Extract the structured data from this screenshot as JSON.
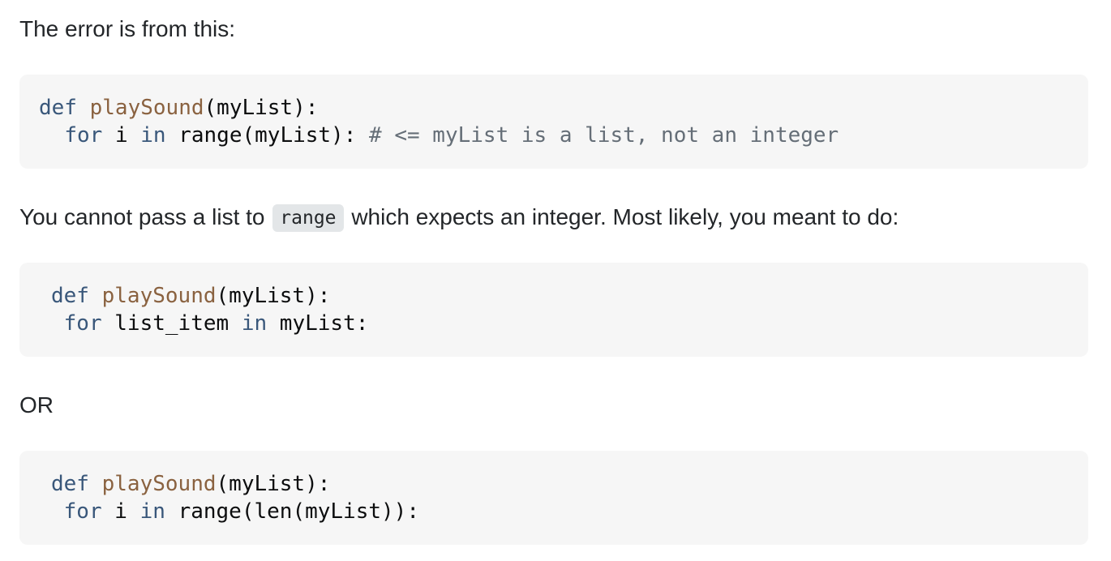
{
  "paragraphs": {
    "intro": "The error is from this:",
    "explanation_before": "You cannot pass a list to",
    "explanation_code": "range",
    "explanation_after": "which expects an integer. Most likely, you meant to do:",
    "or": "OR"
  },
  "code_blocks": [
    {
      "lines": [
        {
          "kw1": "def",
          "fn": "playSound",
          "rest": "(myList):"
        },
        {
          "kw1": "for",
          "a": "i",
          "kw2": "in",
          "rest": "range(myList):",
          "comment": "# <= myList is a list, not an integer"
        }
      ]
    },
    {
      "lines": [
        {
          "kw1": "def",
          "fn": "playSound",
          "rest": "(myList):"
        },
        {
          "kw1": "for",
          "a": "list_item",
          "kw2": "in",
          "rest": "myList:"
        }
      ]
    },
    {
      "lines": [
        {
          "kw1": "def",
          "fn": "playSound",
          "rest": "(myList):"
        },
        {
          "kw1": "for",
          "a": "i",
          "kw2": "in",
          "rest": "range(len(myList)):"
        }
      ]
    }
  ],
  "colors": {
    "keyword": "#39577a",
    "function_name": "#8a6240",
    "comment": "#656e77",
    "code_background": "#f6f6f6",
    "inline_code_background": "#e3e6e8"
  }
}
